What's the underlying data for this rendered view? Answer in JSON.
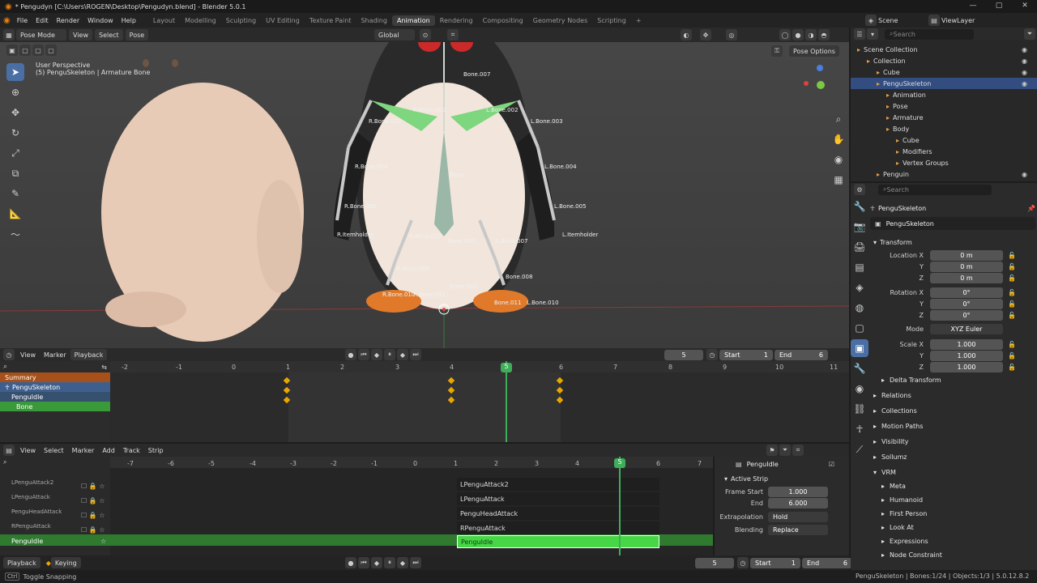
{
  "window": {
    "title": "* Pengudyn [C:\\Users\\ROGEN\\Desktop\\Pengudyn.blend] - Blender 5.0.1",
    "controls": [
      "—",
      "▢",
      "✕"
    ]
  },
  "menubar": {
    "menus": [
      "File",
      "Edit",
      "Render",
      "Window",
      "Help"
    ],
    "workspaces": [
      "Layout",
      "Modelling",
      "Sculpting",
      "UV Editing",
      "Texture Paint",
      "Shading",
      "Animation",
      "Rendering",
      "Compositing",
      "Geometry Nodes",
      "Scripting",
      "+"
    ],
    "active_workspace": "Animation",
    "scene": "Scene",
    "view_layer": "ViewLayer"
  },
  "viewport": {
    "mode": "Pose Mode",
    "menus": [
      "View",
      "Select",
      "Pose"
    ],
    "transform_orientation": "Global",
    "overlay_title": "User Perspective",
    "overlay_subtitle": "(5) PenguSkeleton | Armature Bone",
    "pose_options": "Pose Options",
    "bones": [
      "Bone.007",
      "R.Bone.002",
      "L.Bone.002",
      "R.Bone.003",
      "L.Bone.003",
      "R.Bone.004",
      "Bone",
      "L.Bone.004",
      "R.Bone.005",
      "L.Bone.005",
      "R.Itemholder",
      "L.Itemholder",
      "R.Bone.007",
      "Bone.005",
      "L.Bone.007",
      "R.Bone.008",
      "Bone.008",
      "R.Bone.010",
      "R.Bone.011",
      "Bone.002",
      "Bone.011",
      "L.Bone.010"
    ]
  },
  "dopesheet": {
    "menus": [
      "View",
      "Marker"
    ],
    "playback": "Playback",
    "current_frame": "5",
    "start_label": "Start",
    "start": "1",
    "end_label": "End",
    "end": "6",
    "ruler": [
      "-2",
      "-1",
      "0",
      "1",
      "2",
      "3",
      "4",
      "5",
      "6",
      "7",
      "8",
      "9",
      "10",
      "11"
    ],
    "channels": [
      "Summary",
      "PenguSkeleton",
      "PenguIdle",
      "Bone"
    ],
    "keyframes_at": [
      1,
      4,
      6
    ]
  },
  "nla": {
    "menus": [
      "View",
      "Select",
      "Marker",
      "Add",
      "Track",
      "Strip"
    ],
    "ruler": [
      "-7",
      "-6",
      "-5",
      "-4",
      "-3",
      "-2",
      "-1",
      "0",
      "1",
      "2",
      "3",
      "4",
      "5",
      "6",
      "7"
    ],
    "tracks": [
      "LPenguAttack2",
      "LPenguAttack",
      "PenguHeadAttack",
      "RPenguAttack",
      "PenguIdle"
    ],
    "strips": [
      "LPenguAttack2",
      "LPenguAttack",
      "PenguHeadAttack",
      "RPenguAttack",
      "PenguIdle"
    ],
    "active_strip": "PenguIdle",
    "side": {
      "action": "PenguIdle",
      "section": "Active Strip",
      "frame_start_label": "Frame Start",
      "frame_start": "1.000",
      "end_label": "End",
      "end": "6.000",
      "extrapolation_label": "Extrapolation",
      "extrapolation": "Hold",
      "blending_label": "Blending",
      "blending": "Replace"
    }
  },
  "playback_bar": {
    "playback": "Playback",
    "keying": "Keying",
    "frame": "5",
    "start_label": "Start",
    "start": "1",
    "end_label": "End",
    "end": "6"
  },
  "outliner": {
    "search_placeholder": "Search",
    "rows": [
      {
        "label": "Scene Collection",
        "indent": 0
      },
      {
        "label": "Collection",
        "indent": 1
      },
      {
        "label": "Cube",
        "indent": 2
      },
      {
        "label": "PenguSkeleton",
        "indent": 2
      },
      {
        "label": "Animation",
        "indent": 3
      },
      {
        "label": "Pose",
        "indent": 3
      },
      {
        "label": "Armature",
        "indent": 3
      },
      {
        "label": "Body",
        "indent": 3
      },
      {
        "label": "Cube",
        "indent": 4
      },
      {
        "label": "Modifiers",
        "indent": 4
      },
      {
        "label": "Vertex Groups",
        "indent": 4
      },
      {
        "label": "Penguin",
        "indent": 2
      }
    ]
  },
  "properties": {
    "search_placeholder": "Search",
    "object_name": "PenguSkeleton",
    "object_field": "PenguSkeleton",
    "transform": "Transform",
    "location_label": "Location X",
    "location": [
      "0 m",
      "0 m",
      "0 m"
    ],
    "rotation_label": "Rotation X",
    "rotation": [
      "0°",
      "0°",
      "0°"
    ],
    "mode_label": "Mode",
    "mode": "XYZ Euler",
    "scale_label": "Scale X",
    "scale": [
      "1.000",
      "1.000",
      "1.000"
    ],
    "axis_labels": [
      "Y",
      "Z"
    ],
    "sections": [
      "Delta Transform",
      "Relations",
      "Collections",
      "Motion Paths",
      "Visibility",
      "Sollumz"
    ],
    "vrm": "VRM",
    "vrm_items": [
      "Meta",
      "Humanoid",
      "First Person",
      "Look At",
      "Expressions",
      "Node Constraint"
    ]
  },
  "status": {
    "left": "Toggle Snapping",
    "right": "PenguSkeleton | Bones:1/24 | Objects:1/3 | 5.0.1",
    "version_badge": "2.8.2"
  }
}
